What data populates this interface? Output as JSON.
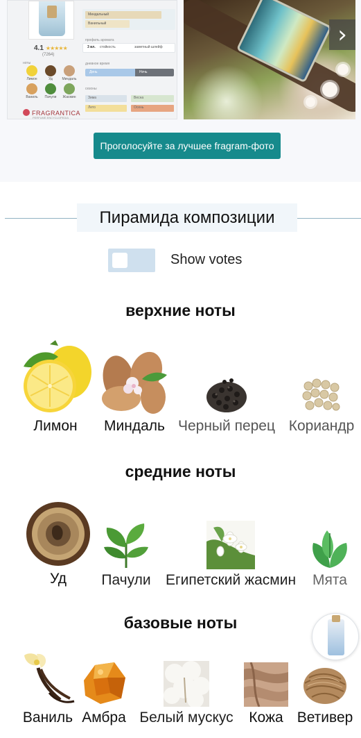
{
  "photos": {
    "left_card": {
      "accords": [
        "Миндальный",
        "Ванильный"
      ],
      "rating_value": "4.1",
      "rating_count": "(7264)",
      "notes_caption": "ноты",
      "mini_notes": [
        {
          "label": "Лимон",
          "color": "#f1d23a"
        },
        {
          "label": "Уд",
          "color": "#6b4a2a"
        },
        {
          "label": "Миндаль",
          "color": "#c9a07a"
        },
        {
          "label": "Ваниль",
          "color": "#d8a15e"
        },
        {
          "label": "Пачули",
          "color": "#4f8d3c"
        },
        {
          "label": "Жасмин",
          "color": "#7ea65c"
        }
      ],
      "profile_caption": "профиль аромата",
      "longevity": "3 вл.",
      "longevity_label": "стойкость",
      "sillage": "заметный шлейф",
      "time_caption": "дневное время",
      "day_label": "День",
      "night_label": "Ночь",
      "seasons_caption": "сезоны",
      "seasons": [
        "Зима",
        "Весна",
        "Лето",
        "Осень"
      ],
      "brand": "FRAGRANTICA",
      "brand_sub": "PERFUME ENCYCLOPEDIA"
    },
    "next_icon": "chevron-right"
  },
  "vote_button": "Проголосуйте за лучшее fragram-фото",
  "pyramid": {
    "title": "Пирамида композиции",
    "toggle_label": "Show votes",
    "sections": [
      {
        "heading": "верхние ноты",
        "notes": [
          {
            "label": "Лимон",
            "icon": "lemon"
          },
          {
            "label": "Миндаль",
            "icon": "almond"
          },
          {
            "label": "Черный перец",
            "icon": "black-pepper"
          },
          {
            "label": "Кориандр",
            "icon": "coriander"
          }
        ]
      },
      {
        "heading": "средние ноты",
        "notes": [
          {
            "label": "Уд",
            "icon": "oud"
          },
          {
            "label": "Пачули",
            "icon": "patchouli"
          },
          {
            "label": "Египетский жасмин",
            "icon": "jasmine"
          },
          {
            "label": "Мята",
            "icon": "mint"
          }
        ]
      },
      {
        "heading": "базовые ноты",
        "notes": [
          {
            "label": "Ваниль",
            "icon": "vanilla"
          },
          {
            "label": "Амбра",
            "icon": "amber"
          },
          {
            "label": "Белый мускус",
            "icon": "white-musk"
          },
          {
            "label": "Кожа",
            "icon": "leather"
          },
          {
            "label": "Ветивер",
            "icon": "vetiver"
          }
        ]
      }
    ]
  },
  "colors": {
    "accent_button": "#168a8c",
    "title_box": "#f1f6fa",
    "toggle_bg": "#cfe0ee",
    "divider": "#8fb2c2"
  }
}
